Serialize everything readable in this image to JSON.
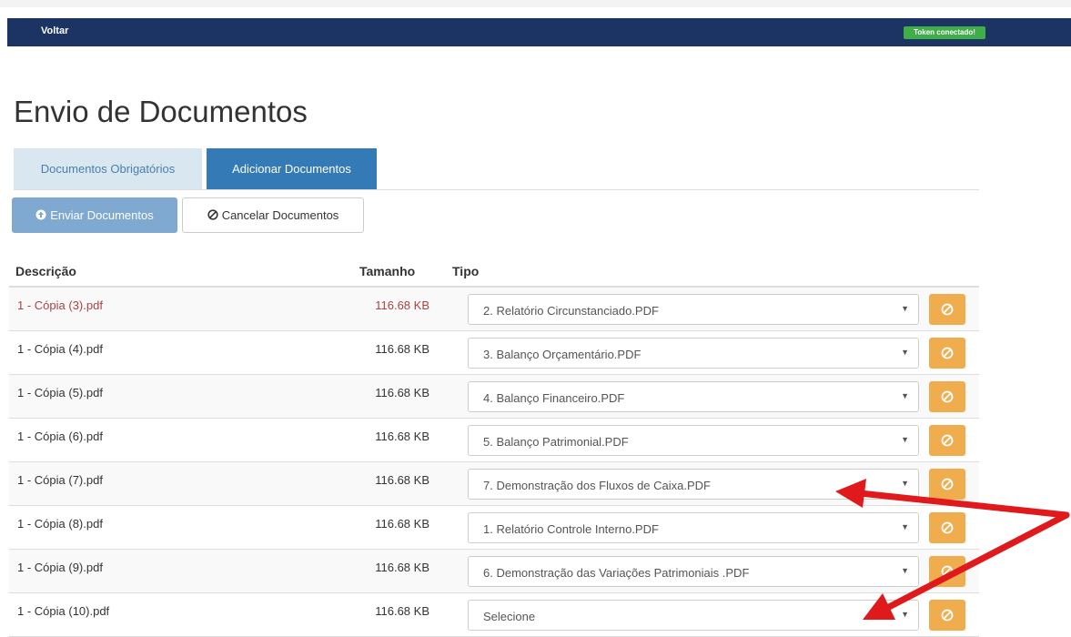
{
  "navbar": {
    "back_label": "Voltar",
    "token_label": "Token conectado!"
  },
  "page_title": "Envio de Documentos",
  "tabs": [
    {
      "label": "Documentos Obrigatórios",
      "active": false
    },
    {
      "label": "Adicionar Documentos",
      "active": true
    }
  ],
  "toolbar": {
    "send_label": "Enviar Documentos",
    "send_icon": "upload-circle-icon",
    "cancel_label": "Cancelar Documentos",
    "cancel_icon": "ban-icon"
  },
  "table": {
    "headers": {
      "description": "Descrição",
      "size": "Tamanho",
      "type": "Tipo"
    },
    "rows": [
      {
        "description": "1 - Cópia (3).pdf",
        "size": "116.68 KB",
        "type": "2. Relatório Circunstanciado.PDF"
      },
      {
        "description": "1 - Cópia (4).pdf",
        "size": "116.68 KB",
        "type": "3. Balanço Orçamentário.PDF"
      },
      {
        "description": "1 - Cópia (5).pdf",
        "size": "116.68 KB",
        "type": "4. Balanço Financeiro.PDF"
      },
      {
        "description": "1 - Cópia (6).pdf",
        "size": "116.68 KB",
        "type": "5. Balanço Patrimonial.PDF"
      },
      {
        "description": "1 - Cópia (7).pdf",
        "size": "116.68 KB",
        "type": "7. Demonstração dos Fluxos de Caixa.PDF"
      },
      {
        "description": "1 - Cópia (8).pdf",
        "size": "116.68 KB",
        "type": "1. Relatório Controle Interno.PDF"
      },
      {
        "description": "1 - Cópia (9).pdf",
        "size": "116.68 KB",
        "type": "6. Demonstração das Variações Patrimoniais .PDF"
      },
      {
        "description": "1 - Cópia (10).pdf",
        "size": "116.68 KB",
        "type": "Selecione"
      }
    ]
  },
  "colors": {
    "navbar": "#1c3463",
    "token_badge": "#3fae49",
    "active_tab": "#337ab7",
    "remove_button": "#f0ad4e",
    "first_row_text": "#a94442",
    "annotation_arrow": "#e0191c"
  }
}
